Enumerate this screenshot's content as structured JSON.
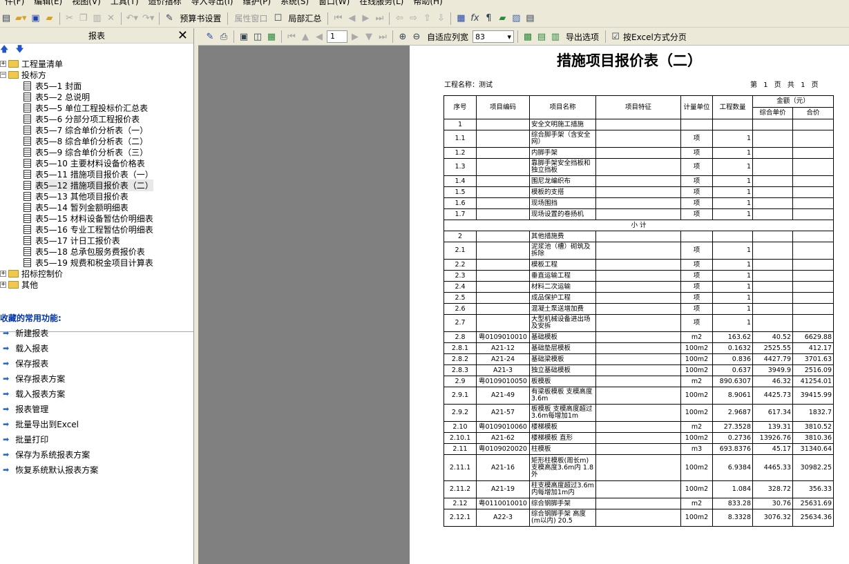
{
  "menu": [
    "件(F)",
    "编辑(E)",
    "视图(V)",
    "工具(T)",
    "造价指标",
    "导入导出(I)",
    "维护(P)",
    "系统(S)",
    "窗口(W)",
    "在线服务(L)",
    "帮助(H)"
  ],
  "toolbar1": {
    "budget_settings": "预算书设置",
    "property_window": "属性窗口",
    "partial_summary": "局部汇总"
  },
  "left": {
    "title": "报表",
    "close": "✕",
    "tree": {
      "n0": "工程量清单",
      "n1": "投标方",
      "r1": "表5—1 封面",
      "r2": "表5—2 总说明",
      "r3": "表5—5 单位工程投标价汇总表",
      "r4": "表5—6 分部分项工程报价表",
      "r5": "表5—7 综合单价分析表（一）",
      "r6": "表5—8 综合单价分析表（二）",
      "r7": "表5—9 综合单价分析表（三）",
      "r8": "表5—10 主要材料设备价格表",
      "r9": "表5—11 措施项目报价表（一）",
      "r10": "表5—12 措施项目报价表（二）",
      "r11": "表5—13 其他项目报价表",
      "r12": "表5—14 暂列金额明细表",
      "r13": "表5—15 材料设备暂估价明细表",
      "r14": "表5—16 专业工程暂估价明细表",
      "r15": "表5—17 计日工报价表",
      "r16": "表5—18 总承包服务费报价表",
      "r17": "表5—19 规费和税金项目计算表",
      "n2": "招标控制价",
      "n3": "其他"
    },
    "fav_title": "收藏的常用功能:",
    "favs": {
      "f1": "新建报表",
      "f2": "载入报表",
      "f3": "保存报表",
      "f4": "保存报表方案",
      "f5": "载入报表方案",
      "f6": "报表管理",
      "f7": "批量导出到Excel",
      "f8": "批量打印",
      "f9": "保存为系统报表方案",
      "f10": "恢复系统默认报表方案"
    }
  },
  "toolbar2": {
    "page": "1",
    "fit_width": "自适应列宽",
    "zoom": "83",
    "export_options": "导出选项",
    "excel_paging": "按Excel方式分页"
  },
  "report": {
    "title": "措施项目报价表（二）",
    "project": "工程名称：测试",
    "page_info": "第 1 页 共 1 页",
    "headers": {
      "seq": "序号",
      "code": "项目编码",
      "name": "项目名称",
      "feature": "项目特征",
      "unit": "计量单位",
      "qty": "工程数量",
      "amount": "金额（元）",
      "unit_price": "综合单价",
      "total": "合价"
    },
    "subtotal": "小 计",
    "rows": [
      [
        "1",
        "",
        "安全文明施工措施",
        "",
        "",
        "",
        ""
      ],
      [
        "1.1",
        "",
        "综合脚手架（含安全网）",
        "项",
        "1",
        "",
        ""
      ],
      [
        "1.2",
        "",
        "内脚手架",
        "项",
        "1",
        "",
        ""
      ],
      [
        "1.3",
        "",
        "靠脚手架安全挡板和独立挡板",
        "项",
        "1",
        "",
        ""
      ],
      [
        "1.4",
        "",
        "围尼龙编织布",
        "项",
        "1",
        "",
        ""
      ],
      [
        "1.5",
        "",
        "模板的支搭",
        "项",
        "1",
        "",
        ""
      ],
      [
        "1.6",
        "",
        "现场围挡",
        "项",
        "1",
        "",
        ""
      ],
      [
        "1.7",
        "",
        "现场设置的卷扬机",
        "项",
        "1",
        "",
        ""
      ],
      [
        "2",
        "",
        "其他措施费",
        "",
        "",
        "",
        ""
      ],
      [
        "2.1",
        "",
        "泥浆池（槽）砌筑及拆除",
        "项",
        "1",
        "",
        ""
      ],
      [
        "2.2",
        "",
        "模板工程",
        "项",
        "1",
        "",
        ""
      ],
      [
        "2.3",
        "",
        "垂直运输工程",
        "项",
        "1",
        "",
        ""
      ],
      [
        "2.4",
        "",
        "材料二次运输",
        "项",
        "1",
        "",
        ""
      ],
      [
        "2.5",
        "",
        "成品保护工程",
        "项",
        "1",
        "",
        ""
      ],
      [
        "2.6",
        "",
        "混凝土泵送增加费",
        "项",
        "1",
        "",
        ""
      ],
      [
        "2.7",
        "",
        "大型机械设备进出场及安拆",
        "项",
        "1",
        "",
        ""
      ],
      [
        "2.8",
        "粤0109010010",
        "基础模板",
        "m2",
        "163.62",
        "40.52",
        "6629.88"
      ],
      [
        "2.8.1",
        "A21-12",
        "基础垫层模板",
        "100m2",
        "0.1632",
        "2525.55",
        "412.17"
      ],
      [
        "2.8.2",
        "A21-24",
        "基础梁模板",
        "100m2",
        "0.836",
        "4427.79",
        "3701.63"
      ],
      [
        "2.8.3",
        "A21-3",
        "独立基础模板",
        "100m2",
        "0.637",
        "3949.9",
        "2516.09"
      ],
      [
        "2.9",
        "粤0109010050",
        "板模板",
        "m2",
        "890.6307",
        "46.32",
        "41254.01"
      ],
      [
        "2.9.1",
        "A21-49",
        "有梁板模板 支模高度3.6m",
        "100m2",
        "8.9061",
        "4425.73",
        "39415.99"
      ],
      [
        "2.9.2",
        "A21-57",
        "板模板 支模高度超过3.6m每增加1m",
        "100m2",
        "2.9687",
        "617.34",
        "1832.7"
      ],
      [
        "2.10",
        "粤0109010060",
        "楼梯模板",
        "m2",
        "27.3528",
        "139.31",
        "3810.52"
      ],
      [
        "2.10.1",
        "A21-62",
        "楼梯模板 直形",
        "100m2",
        "0.2736",
        "13926.76",
        "3810.36"
      ],
      [
        "2.11",
        "粤0109020020",
        "柱模板",
        "m3",
        "693.8376",
        "45.17",
        "31340.64"
      ],
      [
        "2.11.1",
        "A21-16",
        "矩形柱模板(周长m) 支模高度3.6m内 1.8外",
        "100m2",
        "6.9384",
        "4465.33",
        "30982.25"
      ],
      [
        "2.11.2",
        "A21-19",
        "柱支模高度超过3.6m内每增加1m内",
        "100m2",
        "1.084",
        "328.72",
        "356.33"
      ],
      [
        "2.12",
        "粤0110010010",
        "综合钢脚手架",
        "m2",
        "833.28",
        "30.76",
        "25631.69"
      ],
      [
        "2.12.1",
        "A22-3",
        "综合钢脚手架 高度(m以内) 20.5",
        "100m2",
        "8.3328",
        "3076.32",
        "25634.36"
      ]
    ]
  }
}
